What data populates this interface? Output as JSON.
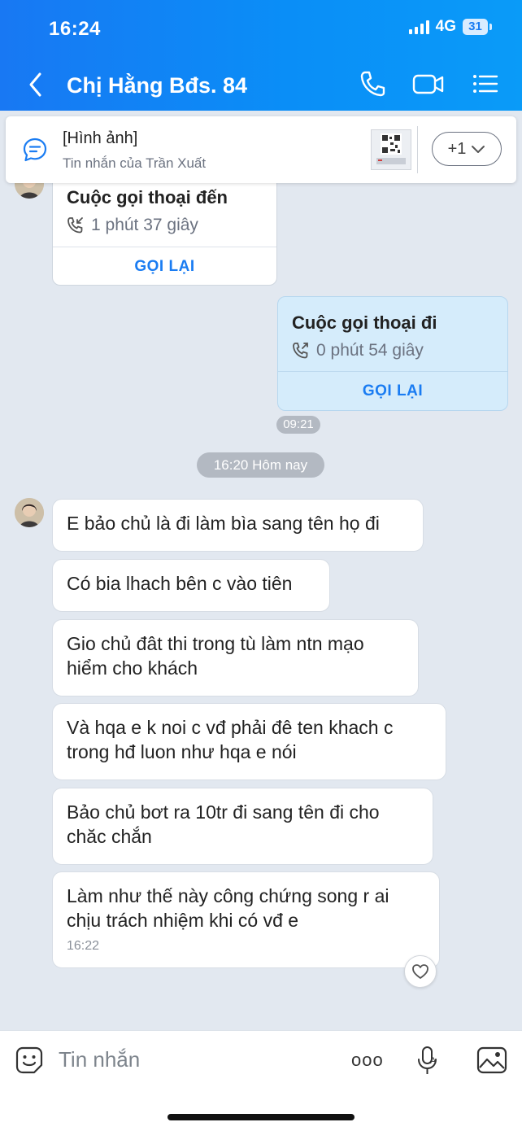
{
  "status_bar": {
    "time": "16:24",
    "network": "4G",
    "battery": "31"
  },
  "header": {
    "title": "Chị Hằng Bđs. 84"
  },
  "pinned": {
    "title": "[Hình ảnh]",
    "subtitle": "Tin nhắn của Trần Xuất",
    "more_label": "+1"
  },
  "calls": [
    {
      "title": "Cuộc gọi thoại đến",
      "duration": "1 phút 37 giây",
      "action": "GỌI LẠI"
    },
    {
      "title": "Cuộc gọi thoại đi",
      "duration": "0 phút 54 giây",
      "action": "GỌI LẠI",
      "time": "09:21"
    }
  ],
  "date_separator": "16:20 Hôm nay",
  "messages": [
    {
      "text": "E bảo chủ là đi làm bìa sang tên họ đi"
    },
    {
      "text": "Có bia lhach bên c vào tiên"
    },
    {
      "text": "Gio chủ đât thi trong tù làm ntn mạo hiểm cho khách"
    },
    {
      "text": "Và hqa e k noi c vđ phải đê ten khach c trong hđ luon như hqa e nói"
    },
    {
      "text": "Bảo chủ bơt ra 10tr đi sang tên đi cho chăc chắn"
    },
    {
      "text": "Làm như thế này công chứng song r ai chịu trách nhiệm khi có vđ e",
      "time": "16:22"
    }
  ],
  "composer": {
    "placeholder": "Tin nhắn",
    "more_label": "ooo"
  },
  "colors": {
    "header": "#1878f3",
    "accent": "#1a7cf2",
    "sent_bubble": "#d5ecfb",
    "background": "#e2e8f0"
  }
}
